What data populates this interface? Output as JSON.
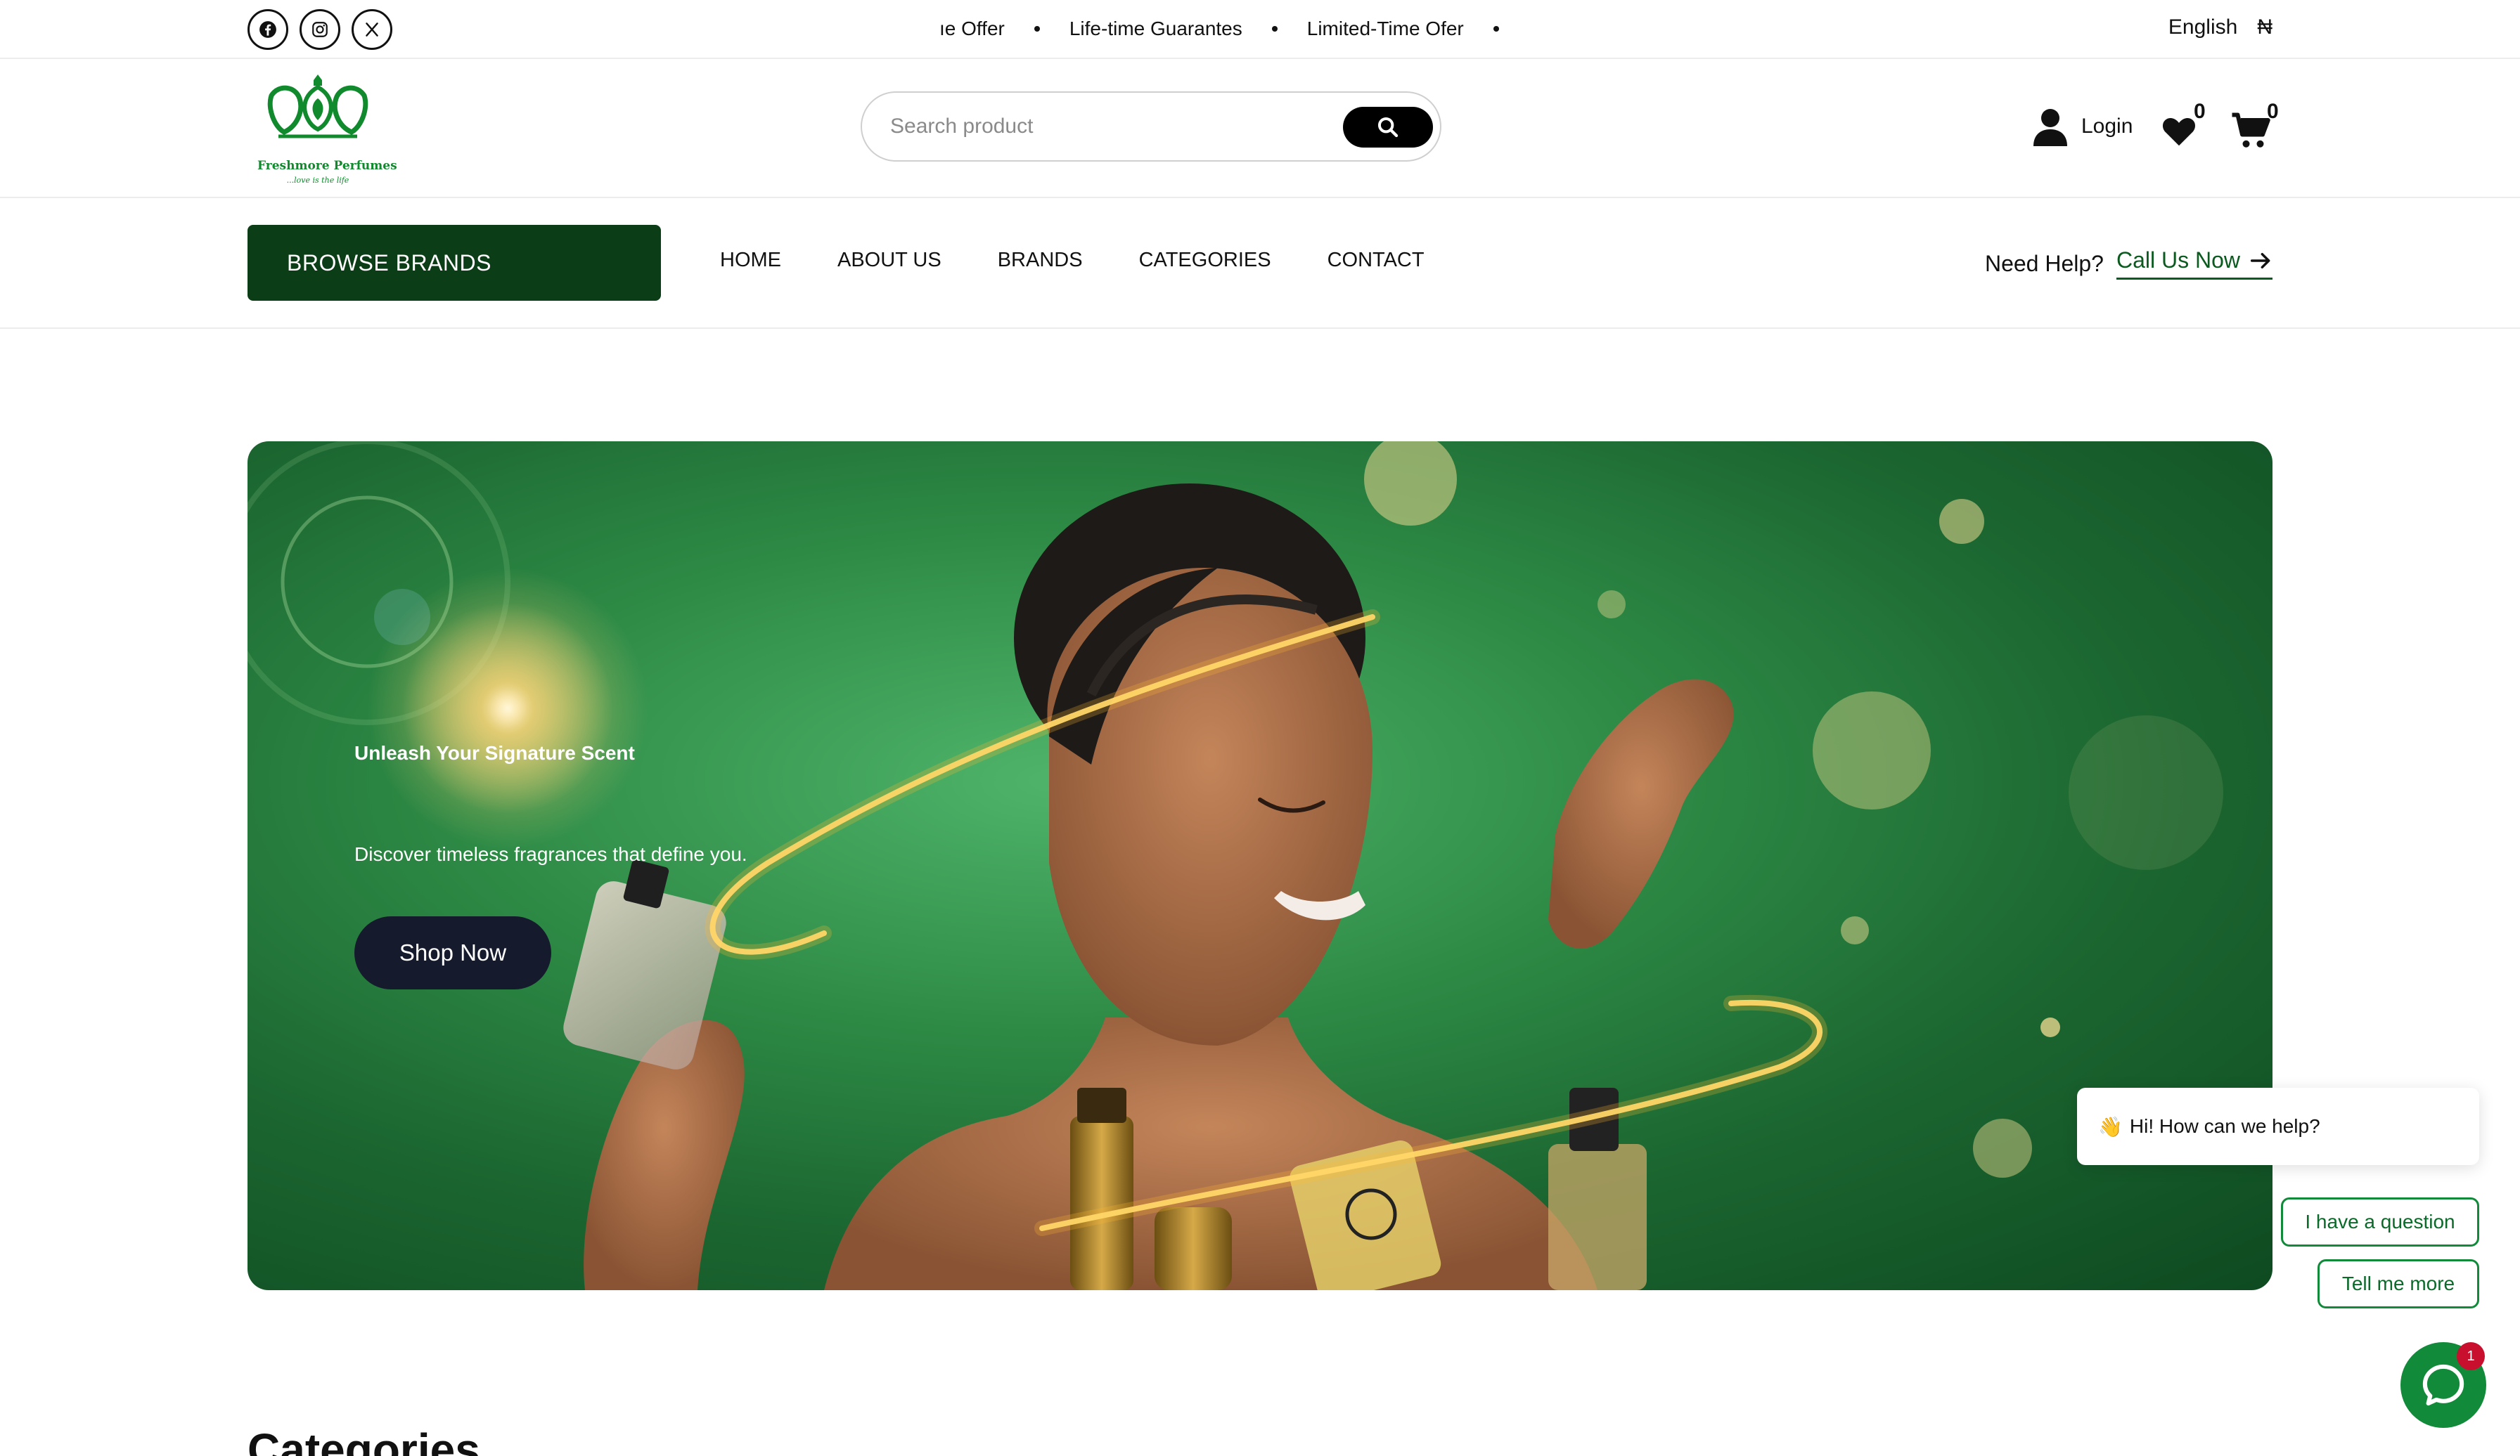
{
  "topbar": {
    "social": [
      {
        "name": "facebook",
        "icon": "facebook-icon"
      },
      {
        "name": "instagram",
        "icon": "instagram-icon"
      },
      {
        "name": "x",
        "icon": "x-icon"
      }
    ],
    "ticker": [
      "ıe Offer",
      "Life-time Guarantes",
      "Limited-Time Ofer"
    ],
    "language": "English",
    "currency": "₦"
  },
  "header": {
    "logo_text": "Freshmore Perfumes",
    "logo_tagline": "...love is the life",
    "search_placeholder": "Search product",
    "login_label": "Login",
    "wishlist_count": "0",
    "cart_count": "0"
  },
  "nav": {
    "browse_label": "BROWSE BRANDS",
    "menu": [
      "HOME",
      "ABOUT US",
      "BRANDS",
      "CATEGORIES",
      "CONTACT"
    ],
    "help_label": "Need Help?",
    "call_label": "Call Us Now"
  },
  "hero": {
    "title": "Unleash Your Signature Scent",
    "subtitle": "Discover timeless fragrances that define you.",
    "cta": "Shop Now"
  },
  "section": {
    "categories_heading": "Categories"
  },
  "chat": {
    "greeting": "Hi! How can we help?",
    "greeting_icon": "waving-hand-icon",
    "options": [
      "I have a question",
      "Tell me more"
    ],
    "unread": "1"
  },
  "colors": {
    "brand_green": "#0b3d16",
    "accent_green": "#118a3a",
    "cta_dark": "#151a2d"
  }
}
